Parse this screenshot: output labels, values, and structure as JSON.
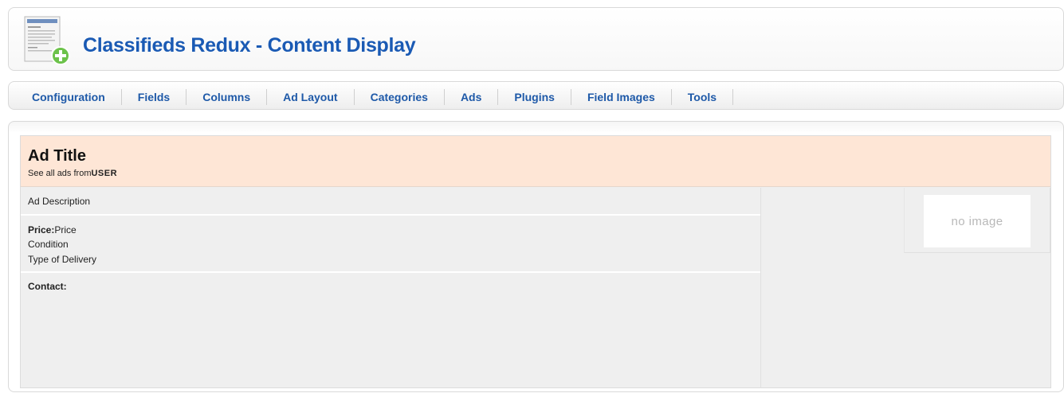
{
  "header": {
    "title": "Classifieds Redux - Content Display",
    "icon": "document-add-icon"
  },
  "toolbar": {
    "items": [
      {
        "label": "Configuration"
      },
      {
        "label": "Fields"
      },
      {
        "label": "Columns"
      },
      {
        "label": "Ad Layout"
      },
      {
        "label": "Categories"
      },
      {
        "label": "Ads"
      },
      {
        "label": "Plugins"
      },
      {
        "label": "Field Images"
      },
      {
        "label": "Tools"
      }
    ]
  },
  "ad": {
    "title": "Ad Title",
    "see_all_prefix": "See all ads from",
    "user": "USER",
    "description": "Ad Description",
    "price_label": "Price:",
    "price_value": "Price",
    "condition": "Condition",
    "delivery": "Type of Delivery",
    "contact_label": "Contact:",
    "no_image": "no image"
  },
  "colors": {
    "title_blue": "#1a5ab4",
    "menu_blue": "#1e59a8",
    "ad_title_band": "#fee6d6",
    "panel_gray": "#efefef"
  }
}
